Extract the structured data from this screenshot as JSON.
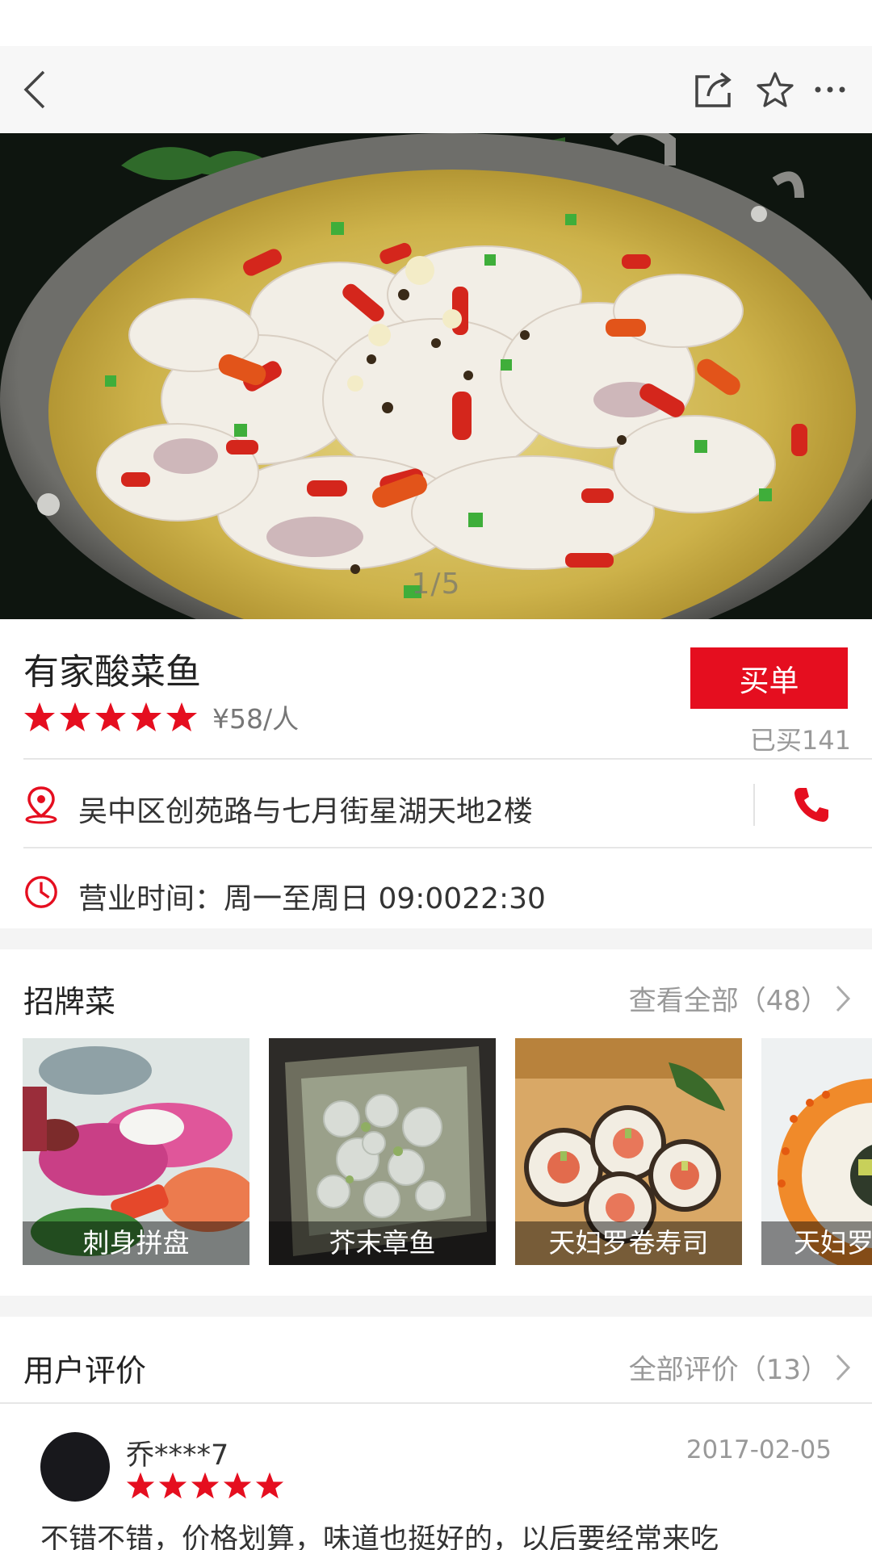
{
  "header": {
    "back_icon": "chevron-left-icon",
    "share_icon": "share-icon",
    "favorite_icon": "star-outline-icon",
    "more_icon": "more-horizontal-icon"
  },
  "hero": {
    "page_indicator": "1/5"
  },
  "shop": {
    "name": "有家酸菜鱼",
    "rating": 5,
    "price_per_person": "¥58/人",
    "buy_label": "买单",
    "sold_count": "已买141",
    "address": "吴中区创苑路与七月街星湖天地2楼",
    "hours": "营业时间：周一至周日  09:0022:30",
    "location_icon": "location-pin-icon",
    "phone_icon": "phone-icon",
    "clock_icon": "clock-icon"
  },
  "signature": {
    "title": "招牌菜",
    "view_all": "查看全部（48）",
    "dishes": [
      {
        "name": "刺身拼盘"
      },
      {
        "name": "芥末章鱼"
      },
      {
        "name": "天妇罗卷寿司"
      },
      {
        "name": "天妇罗"
      }
    ]
  },
  "reviews": {
    "title": "用户评价",
    "all_reviews": "全部评价（13）",
    "items": [
      {
        "user": "乔****7",
        "date": "2017-02-05",
        "rating": 5,
        "text": "不错不错，价格划算，味道也挺好的，以后要经常来吃"
      }
    ]
  },
  "colors": {
    "accent": "#e50e1f",
    "star": "#e50e1f",
    "nav_bg": "#f7f7f7",
    "section_gap": "#f4f4f4"
  }
}
